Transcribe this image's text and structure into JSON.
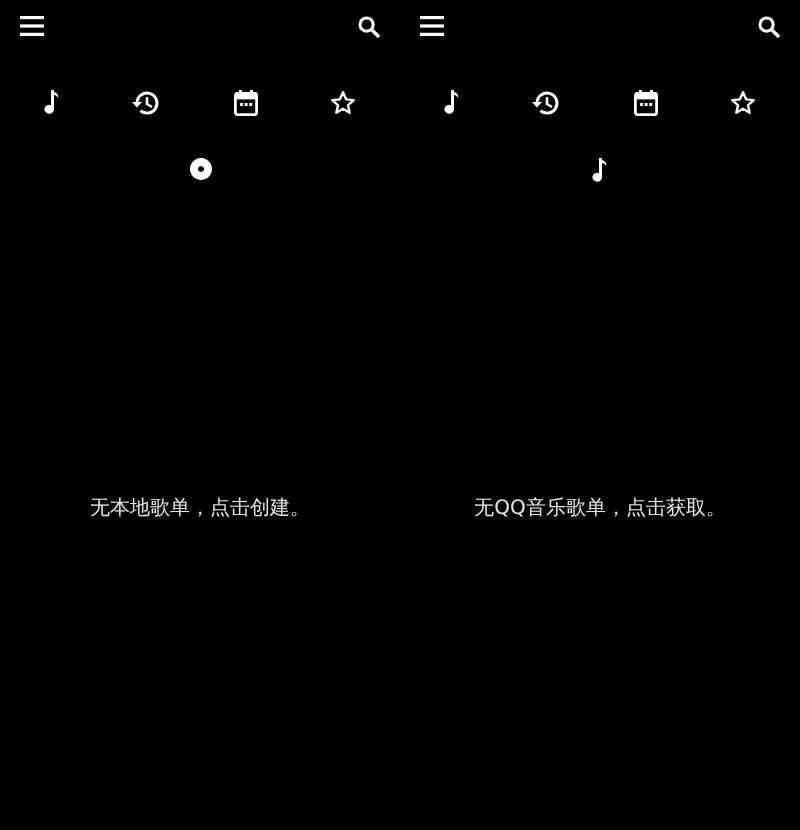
{
  "screens": [
    {
      "source_icon": {
        "kind": "disc"
      },
      "empty_message": "无本地歌单，点击创建。"
    },
    {
      "source_icon": {
        "kind": "note"
      },
      "empty_message": "无QQ音乐歌单，点击获取。"
    }
  ]
}
